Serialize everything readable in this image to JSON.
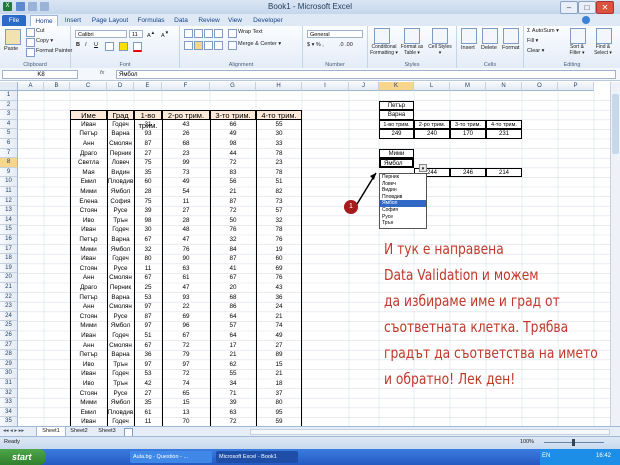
{
  "window": {
    "title": "Book1 - Microsoft Excel",
    "min": "–",
    "max": "□",
    "close": "✕"
  },
  "ribbon_tabs": [
    "File",
    "Home",
    "Insert",
    "Page Layout",
    "Formulas",
    "Data",
    "Review",
    "View",
    "Developer"
  ],
  "ribbon": {
    "paste": "Paste",
    "cut": "Cut",
    "copy": "Copy ▾",
    "format_painter": "Format Painter",
    "clipboard": "Clipboard",
    "font_name": "Calibri",
    "font_size": "11",
    "bold": "B",
    "italic": "I",
    "underline": "U",
    "font": "Font",
    "wrap_text": "Wrap Text",
    "merge_center": "Merge & Center ▾",
    "alignment": "Alignment",
    "number_format": "General",
    "number": "Number",
    "cond_format": "Conditional Formatting ▾",
    "format_table": "Format as Table ▾",
    "cell_styles": "Cell Styles ▾",
    "styles": "Styles",
    "insert": "Insert",
    "delete": "Delete",
    "format": "Format",
    "cells": "Cells",
    "autosum": "Σ AutoSum ▾",
    "fill": "Fill ▾",
    "clear": "Clear ▾",
    "sort_filter": "Sort & Filter ▾",
    "find_select": "Find & Select ▾",
    "editing": "Editing"
  },
  "formula_bar": {
    "name_box": "K8",
    "fx": "fx",
    "value": "Ямбол"
  },
  "columns": [
    "A",
    "B",
    "C",
    "D",
    "E",
    "F",
    "G",
    "H",
    "I",
    "J",
    "K",
    "L",
    "M",
    "N",
    "O",
    "P"
  ],
  "rows": [
    "1",
    "2",
    "3",
    "4",
    "5",
    "6",
    "7",
    "8",
    "9",
    "10",
    "11",
    "12",
    "13",
    "14",
    "15",
    "16",
    "17",
    "18",
    "19",
    "20",
    "21",
    "22",
    "23",
    "24",
    "25",
    "26",
    "27",
    "28",
    "29",
    "30",
    "31",
    "32",
    "33",
    "34",
    "35"
  ],
  "table": {
    "headers": [
      "Име",
      "Град",
      "1-во трим.",
      "2-ро трим.",
      "3-то трим.",
      "4-то трим."
    ],
    "rows": [
      [
        "Иван",
        "Годеч",
        "31",
        "43",
        "66",
        "55"
      ],
      [
        "Петър",
        "Варна",
        "93",
        "26",
        "49",
        "30"
      ],
      [
        "Анн",
        "Смолян",
        "87",
        "68",
        "98",
        "33"
      ],
      [
        "Драго",
        "Перник",
        "27",
        "23",
        "44",
        "78"
      ],
      [
        "Светла",
        "Ловеч",
        "75",
        "99",
        "72",
        "23"
      ],
      [
        "Мая",
        "Видин",
        "35",
        "73",
        "83",
        "78"
      ],
      [
        "Емил",
        "Пловдив",
        "60",
        "49",
        "56",
        "51"
      ],
      [
        "Мими",
        "Ямбол",
        "28",
        "54",
        "21",
        "82"
      ],
      [
        "Елена",
        "София",
        "75",
        "11",
        "87",
        "73"
      ],
      [
        "Стоян",
        "Русе",
        "39",
        "27",
        "72",
        "57"
      ],
      [
        "Иво",
        "Трън",
        "98",
        "28",
        "50",
        "32"
      ],
      [
        "Иван",
        "Годеч",
        "30",
        "48",
        "76",
        "78"
      ],
      [
        "Петър",
        "Варна",
        "67",
        "47",
        "32",
        "76"
      ],
      [
        "Мими",
        "Ямбол",
        "32",
        "76",
        "84",
        "19"
      ],
      [
        "Иван",
        "Годеч",
        "80",
        "90",
        "87",
        "60"
      ],
      [
        "Стоян",
        "Русе",
        "11",
        "63",
        "41",
        "69"
      ],
      [
        "Анн",
        "Смолян",
        "67",
        "61",
        "67",
        "76"
      ],
      [
        "Драго",
        "Перник",
        "25",
        "47",
        "20",
        "43"
      ],
      [
        "Петър",
        "Варна",
        "53",
        "93",
        "68",
        "36"
      ],
      [
        "Анн",
        "Смолян",
        "97",
        "22",
        "86",
        "24"
      ],
      [
        "Стоян",
        "Русе",
        "87",
        "69",
        "64",
        "21"
      ],
      [
        "Мими",
        "Ямбол",
        "97",
        "96",
        "57",
        "74"
      ],
      [
        "Иван",
        "Годеч",
        "51",
        "67",
        "64",
        "49"
      ],
      [
        "Анн",
        "Смолян",
        "67",
        "72",
        "17",
        "27"
      ],
      [
        "Петър",
        "Варна",
        "36",
        "79",
        "21",
        "89"
      ],
      [
        "Иво",
        "Трън",
        "97",
        "97",
        "62",
        "15"
      ],
      [
        "Иван",
        "Годеч",
        "53",
        "72",
        "55",
        "21"
      ],
      [
        "Иво",
        "Трън",
        "42",
        "74",
        "34",
        "18"
      ],
      [
        "Стоян",
        "Русе",
        "27",
        "65",
        "71",
        "37"
      ],
      [
        "Мими",
        "Ямбол",
        "35",
        "15",
        "39",
        "80"
      ],
      [
        "Емил",
        "Пловдив",
        "61",
        "13",
        "63",
        "95"
      ],
      [
        "Иван",
        "Годеч",
        "11",
        "70",
        "72",
        "59"
      ]
    ]
  },
  "lookup1": {
    "name": "Петър",
    "city": "Варна",
    "quarters": [
      "1-во трим.",
      "2-ро трим.",
      "3-то трим.",
      "4-то трим."
    ],
    "values": [
      "249",
      "240",
      "170",
      "231"
    ]
  },
  "lookup2": {
    "name": "Мими",
    "city": "Ямбол",
    "values": [
      "244",
      "244",
      "246",
      "214"
    ]
  },
  "dropdown": [
    "Перник",
    "Ловеч",
    "Видин",
    "Пловдив",
    "Ямбол",
    "София",
    "Русе",
    "Трън"
  ],
  "dropdown_selected": 4,
  "callout": "1",
  "note_lines": [
    "И тук е направена",
    "Data Validation и можем",
    "да избираме име и град от",
    "съответната клетка. Трябва",
    "градът да съответства на името",
    "и обратно! Лек ден!"
  ],
  "sheets": [
    "Sheet1",
    "Sheet2",
    "Sheet3"
  ],
  "status": {
    "ready": "Ready",
    "zoom": "100%"
  },
  "taskbar": {
    "start": "start",
    "app1": "Aula.bg - Question - ...",
    "app2": "Microsoft Excel - Book1",
    "lang": "EN",
    "time": "16:42"
  },
  "colors": {
    "header_fill": "#fde9d9",
    "note": "#c0392b",
    "selected_header": "#f7d58a"
  }
}
